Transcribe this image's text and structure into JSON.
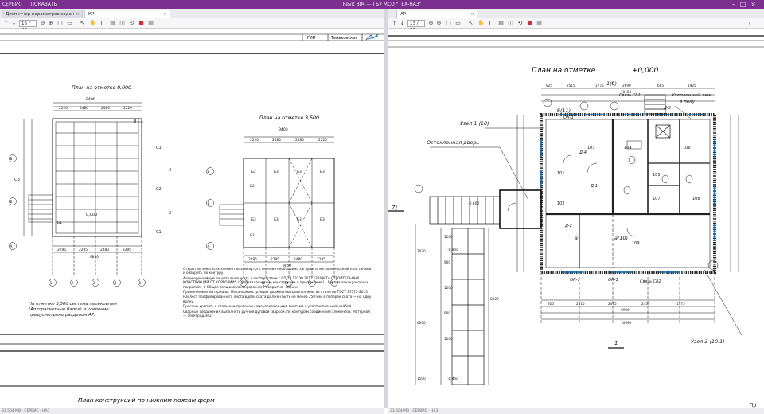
{
  "window": {
    "menu": [
      "СЕРВИС",
      "ПОКАЗАТЬ"
    ],
    "title": "Revit BIM — ГБУ МСО \"ТЕХ-НАЗ\"",
    "controls": [
      "–",
      "□",
      "×"
    ]
  },
  "left": {
    "tabs": [
      {
        "label": "Диспетчер параметров задач"
      },
      {
        "label": "КР"
      }
    ],
    "page_input": "16 / 40",
    "title_block": {
      "label": "ГИП",
      "name": "Теньковская"
    },
    "plan1": {
      "title": "План на отметке 0,000",
      "dims_top": [
        "2220",
        "2480",
        "2480",
        "2220"
      ],
      "total_top": "9400",
      "dims_bottom": [
        "2295",
        "2295",
        "2480",
        "2295"
      ],
      "total_bottom": "9850",
      "axes_bottom": [
        "1",
        "2",
        "3",
        "4",
        "5"
      ],
      "axes_left": [
        "В",
        "Б",
        "А"
      ],
      "marks": [
        "С1",
        "С2",
        "С3",
        "3",
        "2",
        "С1"
      ],
      "beam": "Б1",
      "level": "0,000"
    },
    "plan2": {
      "title": "План на отметке 3,500",
      "dims_top": [
        "2220",
        "2480",
        "2480",
        "2220"
      ],
      "total_top": "9400",
      "dims_bottom": [
        "2295",
        "2295",
        "2480",
        "2295"
      ],
      "total_bottom": "9850",
      "beams": [
        "Б2",
        "Б3",
        "Б3",
        "Б3",
        "Б2",
        "Б3",
        "Б3",
        "Б3",
        "Б3",
        "Б2"
      ],
      "axes_bottom": [
        "1",
        "2",
        "3",
        "4",
        "5"
      ],
      "axes_left": [
        "В",
        "Б",
        "А"
      ]
    },
    "note_left": "На отметке 3,500 система перекрытия (Апторасчетные балки) и усиление предусмотрено разделом АР.",
    "notes": [
      "Открытые зоны всех элементов замкнутого сечения необходимо заглушить металлическими пластинами и обварить по контуру.",
      "Антикоррозийную защиту выполнить в соответствии с СП 28.13330.2017 \"ЗАЩИТА СТРОИТЕЛЬНЫХ КОНСТРУКЦИЙ ОТ КОРРОЗИИ\", п.9 Металлические конструкции и приложение Ц. Группа лакокрасочных покрытий - I. Общая толщина лакокрасочного покрытия - 80мкм.",
      "Применяемые материалы: Металлоконструкции должны быть выполнены из стали по ГОСТ 27772-2015.",
      "Нахлёст профилированного листа вдоль ската должен быть не менее 250 мм, в поперек ската — на одну волну.",
      "Прогоны крепить к стальным прогонам самонарезающими винтами с уплотнительной шайбой.",
      "Сварные соединения выполнять ручной дуговой сваркой, по контурам соединения элементов. Материал — электрод Э42."
    ],
    "bottom_caption": "План конструкций по нижним поясам ферм",
    "status": "33.504 MB · СЕРВИС · НАЗ"
  },
  "right": {
    "tabs": [
      {
        "label": "АР"
      }
    ],
    "page_input": "13 / 23",
    "plan": {
      "title": "План на отметке",
      "level": "+0,000",
      "labels": {
        "axis_b11": "б(11)",
        "axis_1_6": "1(б)",
        "link_c82_top": "Связь С82",
        "hatch": "Утепленный люк",
        "hatch2": "в полу",
        "uzel1": "Узел 1 (10)",
        "glazed_door": "Остекленная дверь",
        "ok1": "ОК-1",
        "link_c82_bottom": "Связь С82",
        "axis_a10": "а(10)",
        "axis_a": "а",
        "d1": "Д-1",
        "d2": "Д-2",
        "d3": "Д-3",
        "d4": "Д-4",
        "level_minus": "-0,600",
        "level_minus2": "-0,950",
        "level_minus3": "-0,450",
        "uzel3": "Узел 3 (10.1)",
        "sheet_num": "1",
        "side_label": "7)",
        "corner_text": "Пр"
      },
      "rooms": [
        "101",
        "102",
        "103",
        "104",
        "105",
        "106",
        "107",
        "108",
        "109"
      ],
      "dims_top": [
        "925",
        "2515",
        "1775",
        "2690",
        "665",
        "1925"
      ],
      "total_top": "10150",
      "dims_bottom": [
        "925",
        "2415",
        "2495",
        "2455",
        "1775"
      ],
      "total_bottom": "9990",
      "total_bottom2": "10090",
      "dims_left": [
        "1200",
        "900",
        "1200",
        "900",
        "1200"
      ],
      "total_left": "6000",
      "stair_total": "8020",
      "left_dim2": "2020",
      "left_dim3": "1500"
    },
    "status": "33.504 MB · СЕРВИС · НАЗ"
  },
  "colors": {
    "titlebar": "#7b2f8e",
    "dimension_line": "#111111",
    "wall_hatch": "#222222",
    "window_frame": "#0d6fb5"
  },
  "icons": [
    "arrow-up-icon",
    "arrow-down-icon",
    "zoom-out-icon",
    "zoom-in-icon",
    "fit-page-icon",
    "cursor-icon",
    "hand-icon",
    "text-select-icon",
    "split-icon",
    "fullscreen-icon",
    "close-icon"
  ]
}
